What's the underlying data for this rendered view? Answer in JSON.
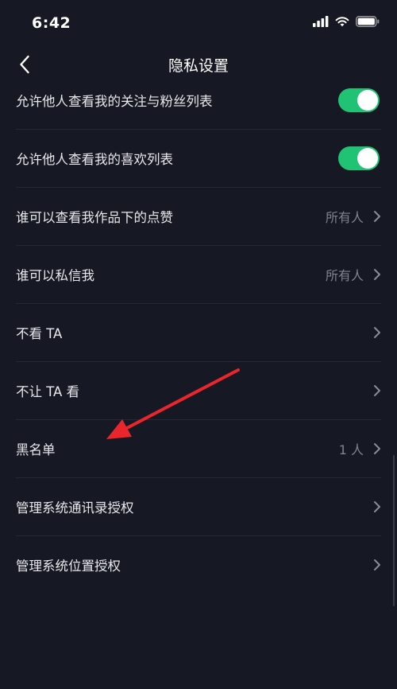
{
  "status_bar": {
    "time": "6:42",
    "icons": [
      "signal-icon",
      "wifi-icon",
      "battery-icon"
    ]
  },
  "nav": {
    "title": "隐私设置",
    "back_icon": "chevron-left-icon"
  },
  "settings": [
    {
      "label": "允许他人查看我的关注与粉丝列表",
      "type": "toggle",
      "on": true
    },
    {
      "label": "允许他人查看我的喜欢列表",
      "type": "toggle",
      "on": true
    },
    {
      "label": "谁可以查看我作品下的点赞",
      "type": "link",
      "value": "所有人"
    },
    {
      "label": "谁可以私信我",
      "type": "link",
      "value": "所有人"
    },
    {
      "label": "不看 TA",
      "type": "link",
      "value": ""
    },
    {
      "label": "不让 TA 看",
      "type": "link",
      "value": ""
    },
    {
      "label": "黑名单",
      "type": "link",
      "value": "1 人"
    },
    {
      "label": "管理系统通讯录授权",
      "type": "link",
      "value": ""
    },
    {
      "label": "管理系统位置授权",
      "type": "link",
      "value": ""
    }
  ],
  "colors": {
    "background": "#161823",
    "toggle_on": "#20c374",
    "annotation_arrow": "#e8262c"
  }
}
